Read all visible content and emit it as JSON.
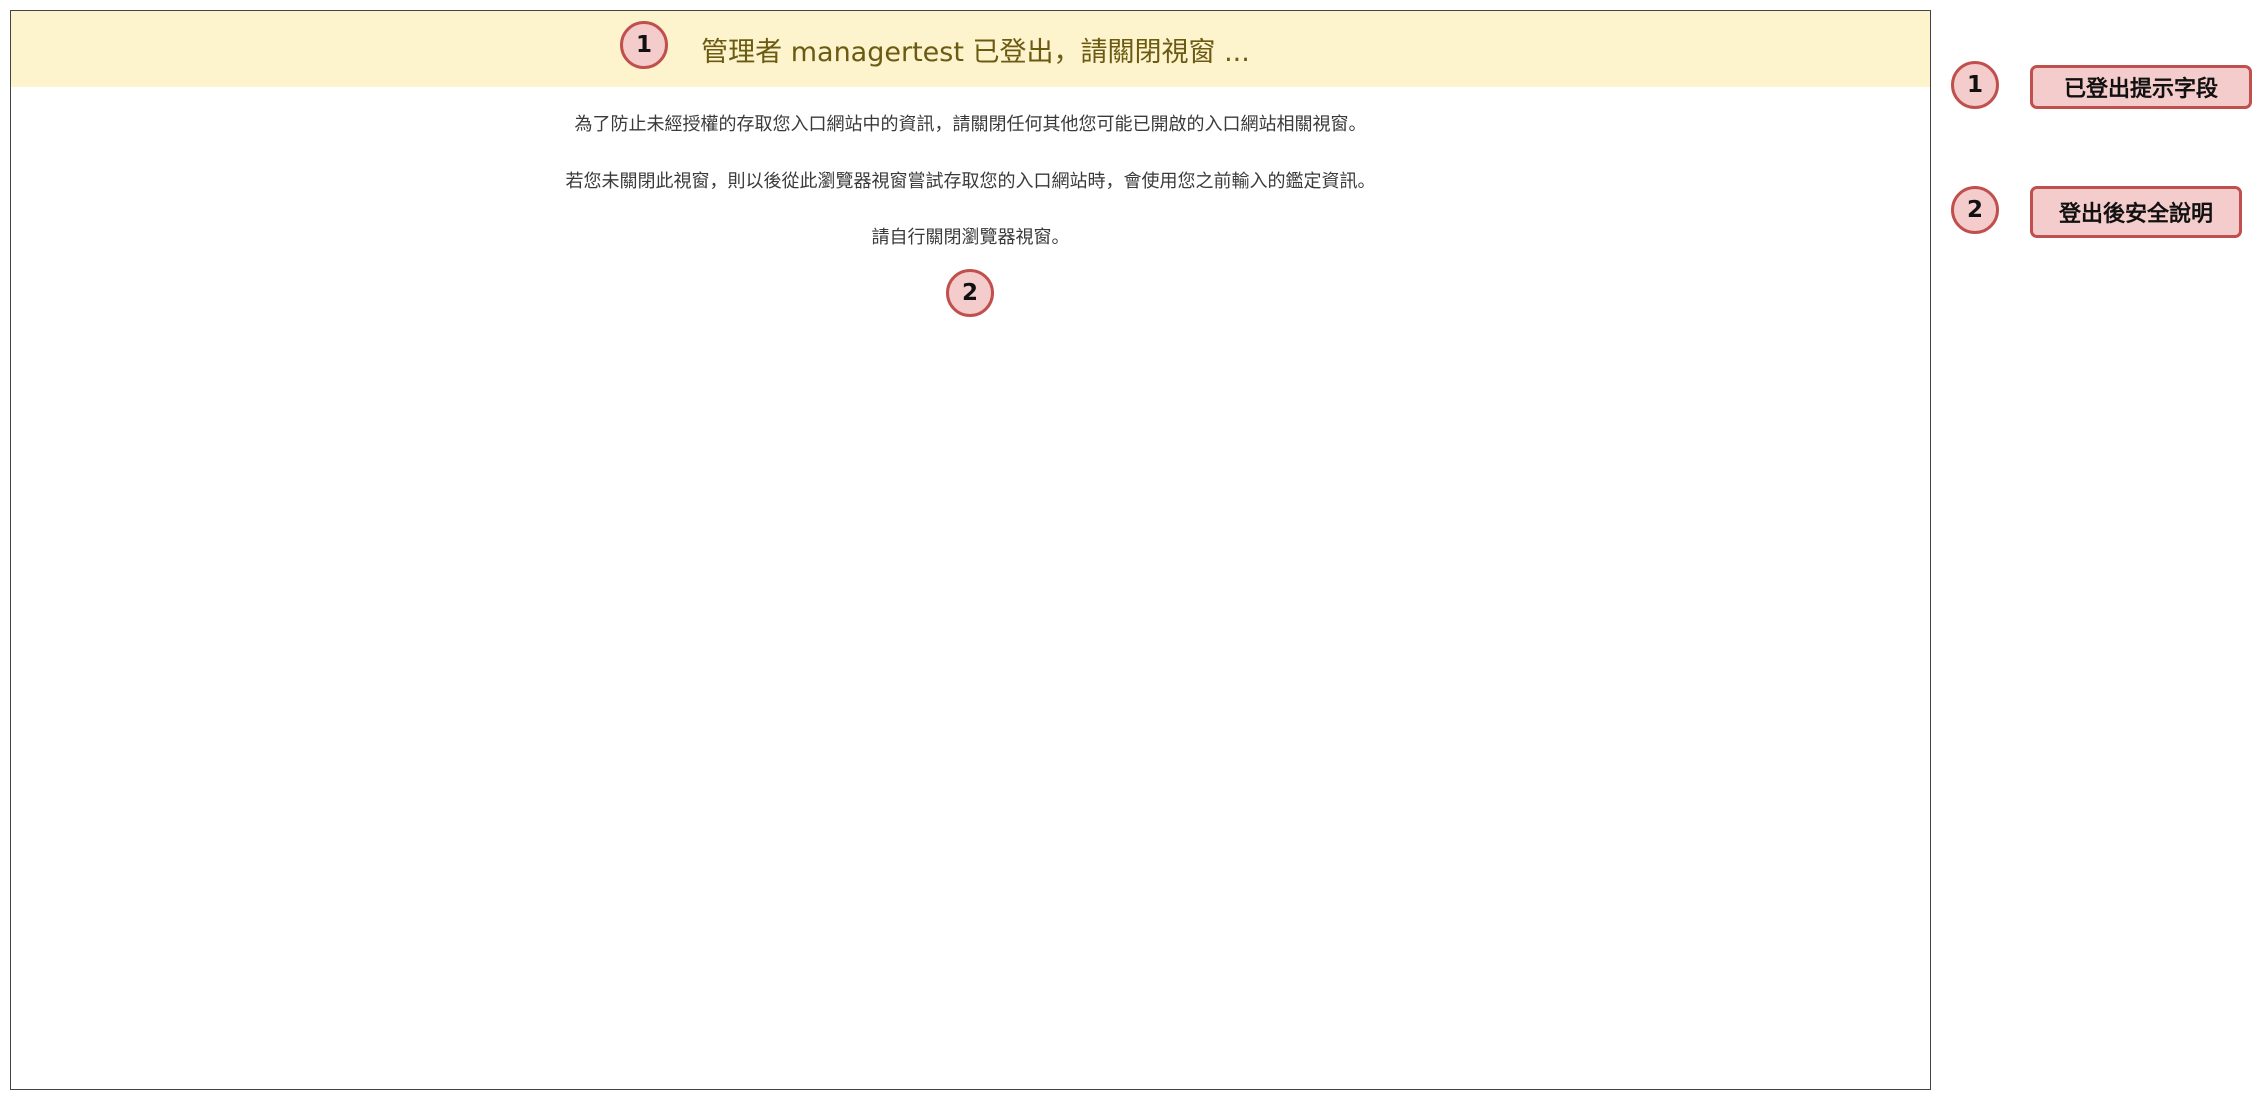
{
  "banner": {
    "message": "管理者 managertest 已登出，請關閉視窗 ..."
  },
  "content": {
    "line1": "為了防止未經授權的存取您入口網站中的資訊，請關閉任何其他您可能已開啟的入口網站相關視窗。",
    "line2": "若您未關閉此視窗，則以後從此瀏覽器視窗嘗試存取您的入口網站時，會使用您之前輸入的鑑定資訊。",
    "line3": "請自行關閉瀏覽器視窗。"
  },
  "annotations": {
    "markers": [
      "1",
      "2"
    ],
    "legend": [
      {
        "number": "1",
        "label": "已登出提示字段"
      },
      {
        "number": "2",
        "label": "登出後安全說明"
      }
    ]
  },
  "colors": {
    "banner_bg": "#fdf3cc",
    "banner_text": "#6b5b12",
    "marker_fill": "#f5cccc",
    "marker_border": "#c0504d"
  }
}
